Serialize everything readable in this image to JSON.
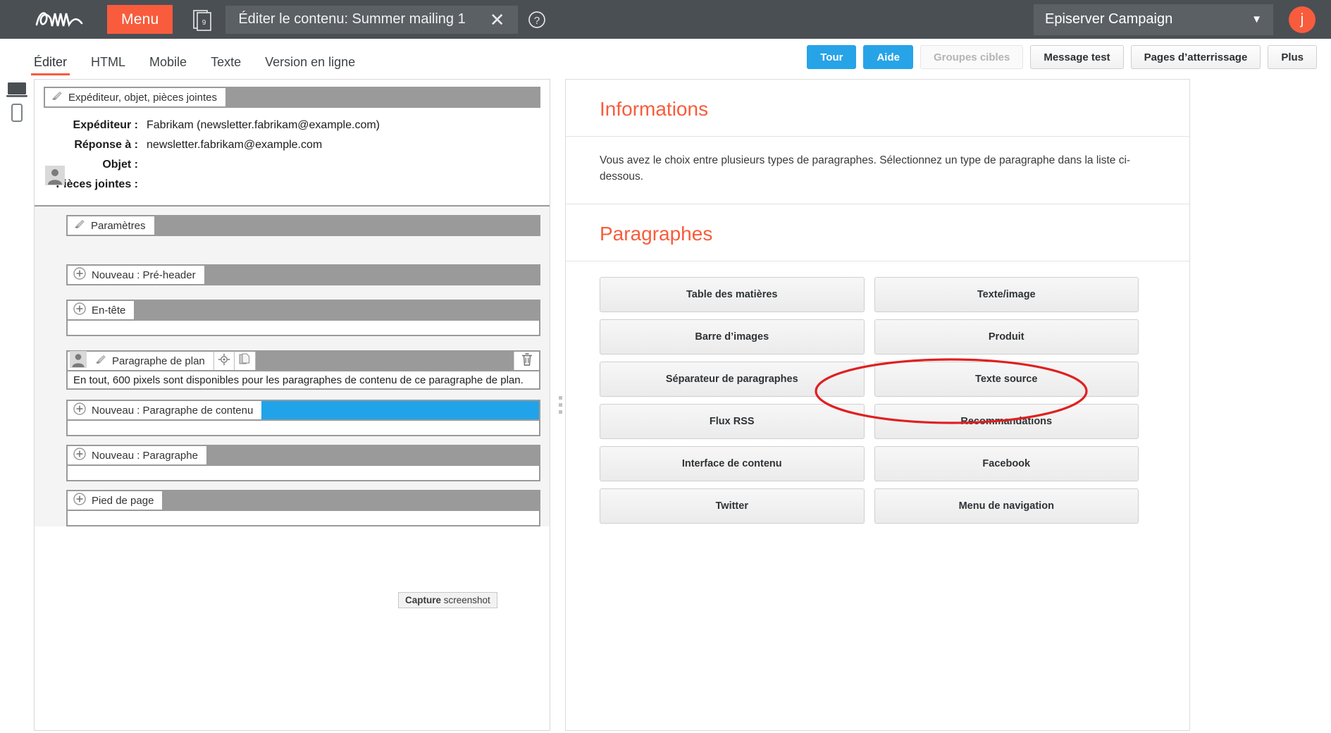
{
  "topbar": {
    "logo_alt": "episerver-logo",
    "menu_label": "Menu",
    "doc_icon_badge": "9",
    "tab_title": "Éditer le contenu: Summer mailing 1",
    "close_label": "✕",
    "help_label": "?",
    "app_name": "Episerver Campaign",
    "avatar_initial": "j",
    "accent_color": "#f85c3c",
    "bar_color": "#4a4f54"
  },
  "subtabs": [
    {
      "label": "Éditer",
      "active": true
    },
    {
      "label": "HTML",
      "active": false
    },
    {
      "label": "Mobile",
      "active": false
    },
    {
      "label": "Texte",
      "active": false
    },
    {
      "label": "Version en ligne",
      "active": false
    }
  ],
  "actions": [
    {
      "label": "Tour",
      "style": "blue"
    },
    {
      "label": "Aide",
      "style": "blue"
    },
    {
      "label": "Groupes cibles",
      "style": "disabled"
    },
    {
      "label": "Message test",
      "style": "grey"
    },
    {
      "label": "Pages d’atterrissage",
      "style": "grey"
    },
    {
      "label": "Plus",
      "style": "grey"
    }
  ],
  "editor": {
    "header_bar_label": "Expéditeur, objet, pièces jointes",
    "fields": [
      {
        "key": "Expéditeur :",
        "value": "Fabrikam (newsletter.fabrikam@example.com)"
      },
      {
        "key": "Réponse à :",
        "value": "newsletter.fabrikam@example.com"
      },
      {
        "key": "Objet :",
        "value": ""
      },
      {
        "key": "Pièces jointes :",
        "value": ""
      }
    ],
    "rows": [
      {
        "label": "Paramètres",
        "icon": "brush-icon",
        "fill": "grey",
        "indent": false
      },
      {
        "label": "Nouveau : Pré-header",
        "icon": "plus-circle-icon",
        "fill": "grey",
        "indent": false
      },
      {
        "label": "En-tête",
        "icon": "plus-circle-icon",
        "fill": "grey",
        "indent": false
      }
    ],
    "plan_row": {
      "label": "Paragraphe de plan",
      "note": "En tout, 600 pixels sont disponibles pour les paragraphes de contenu de ce paragraphe de plan.",
      "icons": [
        "person-icon",
        "brush-icon",
        "target-icon",
        "copy-icon"
      ],
      "trash": "trash-icon"
    },
    "rows_after": [
      {
        "label": "Nouveau : Paragraphe de contenu",
        "icon": "plus-circle-icon",
        "fill": "blue",
        "indent": true
      },
      {
        "label": "Nouveau : Paragraphe",
        "icon": "plus-circle-icon",
        "fill": "grey",
        "indent": false
      },
      {
        "label": "Pied de page",
        "icon": "plus-circle-icon",
        "fill": "grey",
        "indent": false
      }
    ]
  },
  "infopanel": {
    "title": "Informations",
    "body": "Vous avez le choix entre plusieurs types de paragraphes. Sélectionnez un type de paragraphe dans la liste ci-dessous.",
    "paragraphs_title": "Paragraphes",
    "tiles": [
      "Table des matières",
      "Texte/image",
      "Barre d’images",
      "Produit",
      "Séparateur de paragraphes",
      "Texte source",
      "Flux RSS",
      "Recommandations",
      "Interface de contenu",
      "Facebook",
      "Twitter",
      "Menu de navigation"
    ],
    "highlighted_tile": "Recommandations",
    "highlight_color": "#e02020"
  },
  "statusbar": {
    "capture_bold": "Capture",
    "capture_rest": " screenshot"
  }
}
